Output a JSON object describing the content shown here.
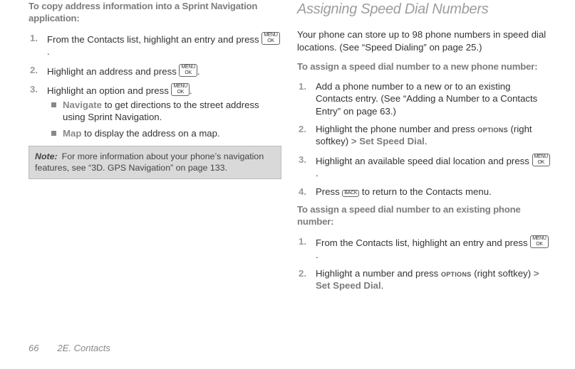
{
  "left": {
    "instr_heading": "To copy address information into a Sprint Navigation application:",
    "steps": [
      {
        "pre": "From the Contacts list, highlight an entry and press ",
        "key": "MENU/OK",
        "post": "."
      },
      {
        "pre": "Highlight an address and press ",
        "key": "MENU/OK",
        "post": "."
      },
      {
        "pre": "Highlight an option and press ",
        "key": "MENU/OK",
        "post": "."
      }
    ],
    "bullets": [
      {
        "kw": "Navigate",
        "text": " to get directions to the street address using Sprint Navigation."
      },
      {
        "kw": "Map",
        "text": " to display the address on a map."
      }
    ],
    "note": {
      "label": "Note:",
      "text": "For more information about your phone’s navigation features, see “3D. GPS Navigation” on page 133."
    }
  },
  "right": {
    "section_title": "Assigning Speed Dial Numbers",
    "intro": "Your phone can store up to 98 phone numbers in speed dial locations. (See “Speed Dialing” on page 25.)",
    "instr_heading_a": "To assign a speed dial number to a new phone number:",
    "steps_a": {
      "s1": "Add a phone number to a new or to an existing Contacts entry. (See “Adding a Number to a Contacts Entry” on page 63.)",
      "s2_pre": "Highlight the phone number and press ",
      "s2_opt": "OPTIONS",
      "s2_mid": " (right softkey) ",
      "s2_gt": ">",
      "s2_cmd": " Set Speed Dial",
      "s2_post": ".",
      "s3_pre": "Highlight an available speed dial location and press ",
      "s3_key": "MENU/OK",
      "s3_post": ".",
      "s4_pre": "Press ",
      "s4_key": "BACK",
      "s4_post": " to return to the Contacts menu."
    },
    "instr_heading_b": "To assign a speed dial number to an existing phone number:",
    "steps_b": {
      "s1_pre": "From the Contacts list, highlight an entry and press ",
      "s1_key": "MENU/OK",
      "s1_post": ".",
      "s2_pre": "Highlight a number and press ",
      "s2_opt": "OPTIONS",
      "s2_mid": " (right softkey) ",
      "s2_gt": ">",
      "s2_cmd": " Set Speed Dial",
      "s2_post": "."
    }
  },
  "footer": {
    "page_number": "66",
    "chapter": "2E. Contacts"
  },
  "keys": {
    "menu_top": "MENU",
    "menu_bot": "OK",
    "back": "BACK"
  }
}
